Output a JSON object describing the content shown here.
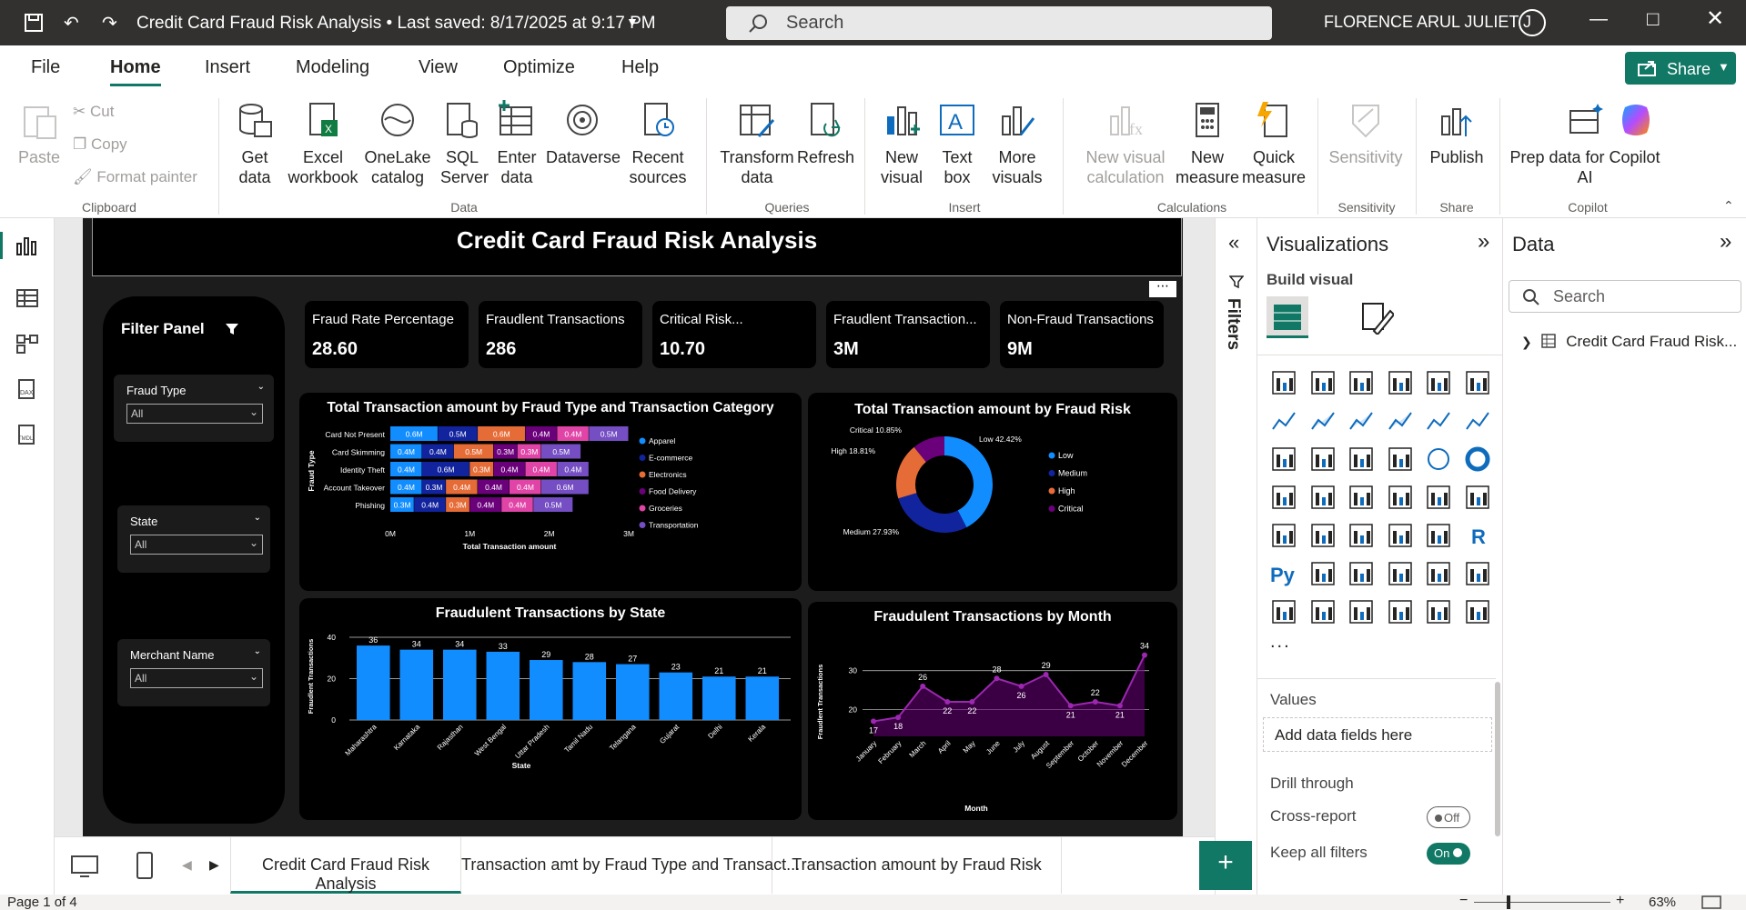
{
  "titlebar": {
    "title": "Credit Card Fraud Risk Analysis • Last saved: 8/17/2025 at 9:17 PM",
    "search_placeholder": "Search",
    "user": "FLORENCE ARUL JULIET J"
  },
  "menu": {
    "items": [
      "File",
      "Home",
      "Insert",
      "Modeling",
      "View",
      "Optimize",
      "Help"
    ],
    "active": "Home",
    "share": "Share"
  },
  "ribbon": {
    "clipboard": {
      "paste": "Paste",
      "cut": "Cut",
      "copy": "Copy",
      "format_painter": "Format painter",
      "group": "Clipboard"
    },
    "data": {
      "get_data": "Get data",
      "excel": "Excel workbook",
      "onelake": "OneLake catalog",
      "sql": "SQL Server",
      "enter": "Enter data",
      "dataverse": "Dataverse",
      "recent": "Recent sources",
      "group": "Data"
    },
    "queries": {
      "transform": "Transform data",
      "refresh": "Refresh",
      "group": "Queries"
    },
    "insert": {
      "new_visual": "New visual",
      "text_box": "Text box",
      "more_visuals": "More visuals",
      "group": "Insert"
    },
    "calculations": {
      "new_visual_calc": "New visual calculation",
      "new_measure": "New measure",
      "quick_measure": "Quick measure",
      "group": "Calculations"
    },
    "sensitivity": {
      "label": "Sensitivity",
      "group": "Sensitivity"
    },
    "share": {
      "publish": "Publish",
      "group": "Share"
    },
    "copilot": {
      "prep": "Prep data for Copilot AI",
      "copilot": "Copilot",
      "group": "Copilot"
    }
  },
  "report": {
    "title": "Credit Card Fraud Risk Analysis",
    "filter_panel": {
      "title": "Filter Panel",
      "slicers": [
        {
          "label": "Fraud Type",
          "value": "All"
        },
        {
          "label": "State",
          "value": "All"
        },
        {
          "label": "Merchant Name",
          "value": "All"
        }
      ]
    },
    "kpis": [
      {
        "label": "Fraud Rate Percentage",
        "value": "28.60"
      },
      {
        "label": "Fraudlent Transactions",
        "value": "286"
      },
      {
        "label": "Critical Risk...",
        "value": "10.70"
      },
      {
        "label": "Fraudlent Transaction...",
        "value": "3M"
      },
      {
        "label": "Non-Fraud Transactions",
        "value": "9M"
      }
    ]
  },
  "chart_data": [
    {
      "type": "bar",
      "stacked": true,
      "orientation": "horizontal",
      "title": "Total Transaction amount by Fraud Type and Transaction Category",
      "xlabel": "Total Transaction amount",
      "ylabel": "Fraud Type",
      "categories": [
        "Card Not Present",
        "Card Skimming",
        "Identity Theft",
        "Account Takeover",
        "Phishing"
      ],
      "x_ticks": [
        "0M",
        "1M",
        "2M",
        "3M"
      ],
      "xlim": [
        0,
        3000000
      ],
      "series": [
        {
          "name": "Apparel",
          "color": "#118DFF",
          "values": [
            600000,
            400000,
            400000,
            400000,
            300000
          ],
          "labels": [
            "0.6M",
            "0.4M",
            "0.4M",
            "0.4M",
            "0.3M"
          ]
        },
        {
          "name": "E-commerce",
          "color": "#12239E",
          "values": [
            500000,
            400000,
            600000,
            300000,
            400000
          ],
          "labels": [
            "0.5M",
            "0.4M",
            "0.6M",
            "0.3M",
            "0.4M"
          ]
        },
        {
          "name": "Electronics",
          "color": "#E66C37",
          "values": [
            600000,
            500000,
            300000,
            400000,
            300000
          ],
          "labels": [
            "0.6M",
            "0.5M",
            "0.3M",
            "0.4M",
            "0.3M"
          ]
        },
        {
          "name": "Food Delivery",
          "color": "#6B007B",
          "values": [
            400000,
            300000,
            400000,
            400000,
            400000
          ],
          "labels": [
            "0.4M",
            "0.3M",
            "0.4M",
            "0.4M",
            "0.4M"
          ]
        },
        {
          "name": "Groceries",
          "color": "#E044A7",
          "values": [
            400000,
            300000,
            400000,
            400000,
            400000
          ],
          "labels": [
            "0.4M",
            "0.3M",
            "0.4M",
            "0.4M",
            "0.4M"
          ]
        },
        {
          "name": "Transportation",
          "color": "#744EC2",
          "values": [
            500000,
            500000,
            400000,
            600000,
            500000
          ],
          "labels": [
            "0.5M",
            "0.5M",
            "0.4M",
            "0.6M",
            "0.5M"
          ]
        }
      ],
      "legend": "right"
    },
    {
      "type": "pie",
      "donut": true,
      "title": "Total Transaction amount by Fraud Risk",
      "slices": [
        {
          "name": "Low",
          "value": 42.42,
          "label": "Low 42.42%",
          "color": "#118DFF"
        },
        {
          "name": "Medium",
          "value": 27.93,
          "label": "Medium 27.93%",
          "color": "#12239E"
        },
        {
          "name": "High",
          "value": 18.81,
          "label": "High 18.81%",
          "color": "#E66C37"
        },
        {
          "name": "Critical",
          "value": 10.85,
          "label": "Critical 10.85%",
          "color": "#6B007B"
        }
      ],
      "legend": "right"
    },
    {
      "type": "bar",
      "title": "Fraudulent Transactions by State",
      "xlabel": "State",
      "ylabel": "Fraudlent Transactions",
      "categories": [
        "Maharashtra",
        "Karnataka",
        "Rajasthan",
        "West Bengal",
        "Uttar Pradesh",
        "Tamil Nadu",
        "Telangana",
        "Gujarat",
        "Delhi",
        "Kerala"
      ],
      "values": [
        36,
        34,
        34,
        33,
        29,
        28,
        27,
        23,
        21,
        21
      ],
      "y_ticks": [
        0,
        20,
        40
      ],
      "ylim": [
        0,
        40
      ],
      "color": "#118DFF"
    },
    {
      "type": "area",
      "title": "Fraudulent Transactions by Month",
      "xlabel": "Month",
      "ylabel": "Fraudlent Transactions",
      "categories": [
        "January",
        "February",
        "March",
        "April",
        "May",
        "June",
        "July",
        "August",
        "September",
        "October",
        "November",
        "December"
      ],
      "values": [
        17,
        18,
        26,
        22,
        22,
        28,
        26,
        29,
        21,
        22,
        21,
        34
      ],
      "y_ticks": [
        20,
        30
      ],
      "ylim": [
        15,
        36
      ],
      "color": "#6B007B"
    }
  ],
  "filters_pane": {
    "label": "Filters"
  },
  "viz_pane": {
    "title": "Visualizations",
    "build_visual": "Build visual",
    "values": "Values",
    "add_fields": "Add data fields here",
    "drill_through": "Drill through",
    "cross_report": "Cross-report",
    "cross_report_state": "Off",
    "keep_filters": "Keep all filters",
    "keep_filters_state": "On",
    "more": "..."
  },
  "data_pane": {
    "title": "Data",
    "search_placeholder": "Search",
    "table": "Credit Card Fraud Risk..."
  },
  "tabs": [
    {
      "label": "Credit Card Fraud Risk Analysis",
      "active": true
    },
    {
      "label": "Transaction amt by Fraud Type and Transact...",
      "active": false
    },
    {
      "label": "Transaction amount by Fraud Risk",
      "active": false
    }
  ],
  "status": {
    "page": "Page 1 of 4",
    "zoom": "63%"
  },
  "colors": {
    "accent": "#117865",
    "chrome": "#323130",
    "canvas": "#000000"
  }
}
